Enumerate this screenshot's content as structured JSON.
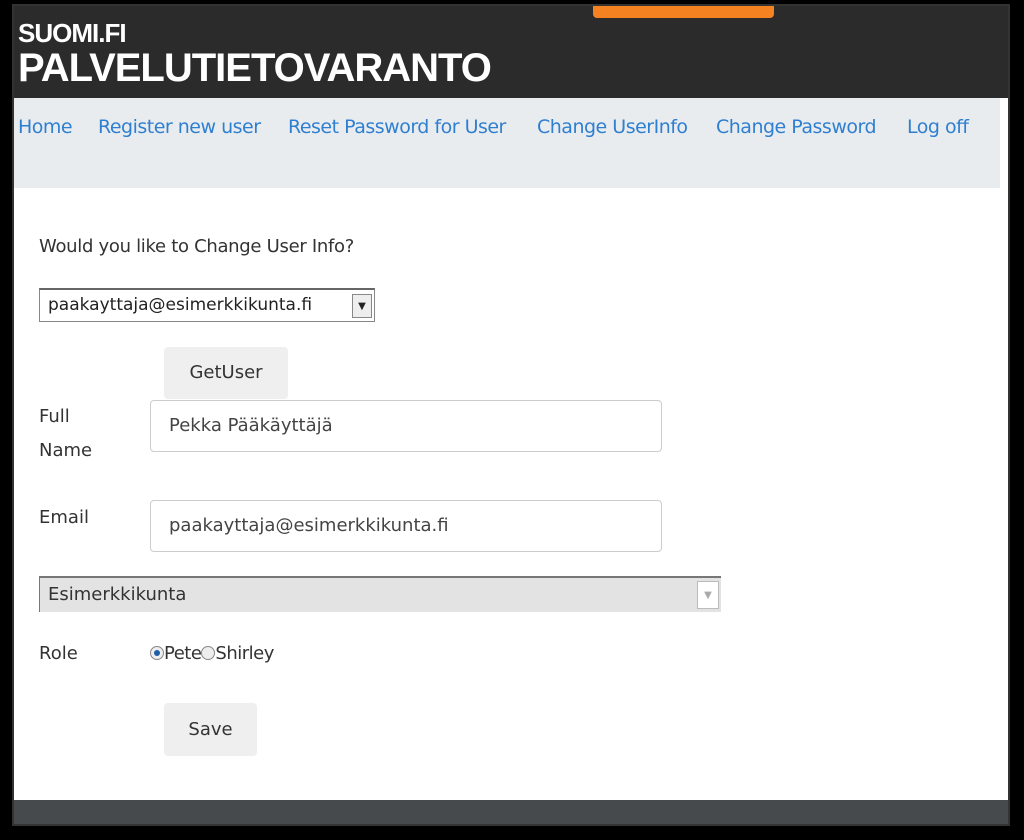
{
  "header": {
    "brand_top": "SUOMI.FI",
    "brand_main": "PALVELUTIETOVARANTO",
    "accent_color": "#f58220"
  },
  "nav": {
    "items": [
      {
        "label": "Home"
      },
      {
        "label": "Register new user"
      },
      {
        "label": "Reset Password for User"
      },
      {
        "label": "Change UserInfo"
      },
      {
        "label": "Change Password"
      },
      {
        "label": "Log off"
      }
    ]
  },
  "form": {
    "question": "Would you like to Change User Info?",
    "user_select": "paakayttaja@esimerkkikunta.fi",
    "get_user_label": "GetUser",
    "full_name_label": "Full Name",
    "full_name_value": "Pekka Pääkäyttäjä",
    "email_label": "Email",
    "email_value": "paakayttaja@esimerkkikunta.fi",
    "organization_select": "Esimerkkikunta",
    "role_label": "Role",
    "roles": [
      {
        "label": "Pete",
        "selected": true
      },
      {
        "label": "Shirley",
        "selected": false
      }
    ],
    "save_label": "Save"
  }
}
